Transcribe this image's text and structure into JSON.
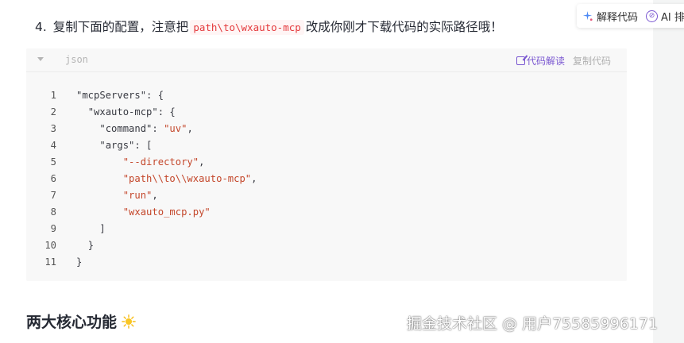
{
  "step": {
    "number": "4.",
    "text_before": "复制下面的配置，注意把",
    "path_code": "path\\to\\wxauto-mcp",
    "text_after": "改成你刚才下载代码的实际路径哦！"
  },
  "toolbar": {
    "explain_label": "解释代码",
    "ai_label": "AI 排"
  },
  "code_block": {
    "language": "json",
    "explain_label": "代码解读",
    "copy_label": "复制代码",
    "lines": [
      {
        "num": "1",
        "indent": "",
        "before": "\"mcpServers\": {",
        "str": "",
        "after": ""
      },
      {
        "num": "2",
        "indent": "  ",
        "before": "\"wxauto-mcp\": {",
        "str": "",
        "after": ""
      },
      {
        "num": "3",
        "indent": "    ",
        "before": "\"command\": ",
        "str": "\"uv\"",
        "after": ","
      },
      {
        "num": "4",
        "indent": "    ",
        "before": "\"args\": [",
        "str": "",
        "after": ""
      },
      {
        "num": "5",
        "indent": "        ",
        "before": "",
        "str": "\"--directory\"",
        "after": ","
      },
      {
        "num": "6",
        "indent": "        ",
        "before": "",
        "str": "\"path\\\\to\\\\wxauto-mcp\"",
        "after": ","
      },
      {
        "num": "7",
        "indent": "        ",
        "before": "",
        "str": "\"run\"",
        "after": ","
      },
      {
        "num": "8",
        "indent": "        ",
        "before": "",
        "str": "\"wxauto_mcp.py\"",
        "after": ""
      },
      {
        "num": "9",
        "indent": "    ",
        "before": "]",
        "str": "",
        "after": ""
      },
      {
        "num": "10",
        "indent": "  ",
        "before": "}",
        "str": "",
        "after": ""
      },
      {
        "num": "11",
        "indent": "",
        "before": "}",
        "str": "",
        "after": ""
      }
    ]
  },
  "section": {
    "title": "两大核心功能",
    "icon": "sun-icon"
  },
  "watermark": "掘金技术社区 @ 用户7558599617­1"
}
